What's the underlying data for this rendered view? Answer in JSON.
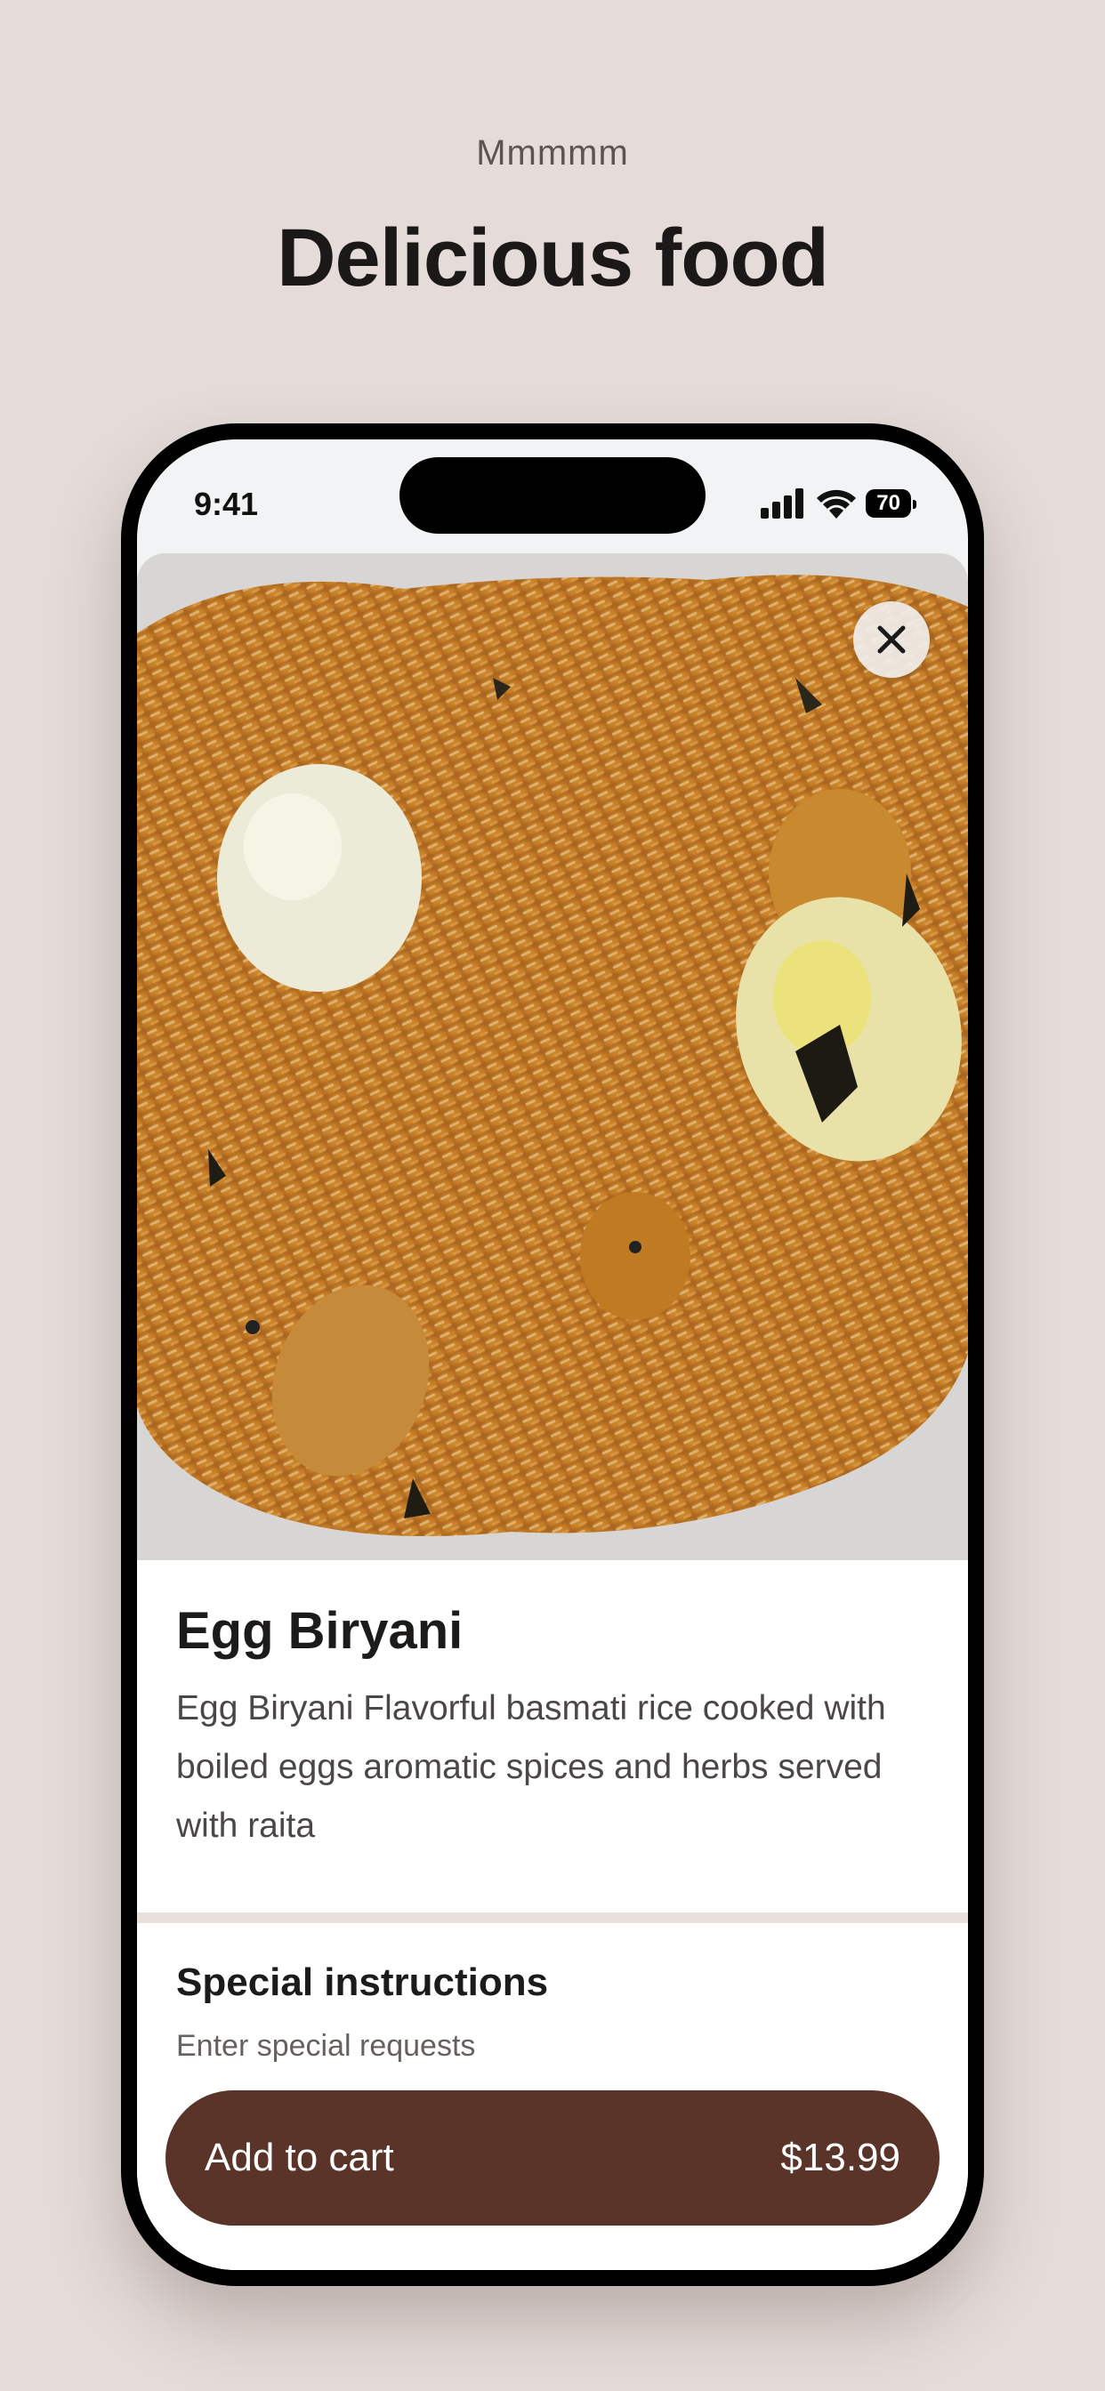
{
  "header": {
    "eyebrow": "Mmmmm",
    "title": "Delicious food"
  },
  "status_bar": {
    "time": "9:41",
    "battery": "70"
  },
  "item": {
    "name": "Egg Biryani",
    "description": "Egg Biryani Flavorful basmati rice cooked with boiled eggs aromatic spices and herbs served with raita",
    "image_icon": "food-photo"
  },
  "instructions": {
    "title": "Special instructions",
    "placeholder": "Enter special requests"
  },
  "cart": {
    "label": "Add to cart",
    "price": "$13.99"
  },
  "colors": {
    "background": "#e5dcd9",
    "button": "#5a3428"
  }
}
